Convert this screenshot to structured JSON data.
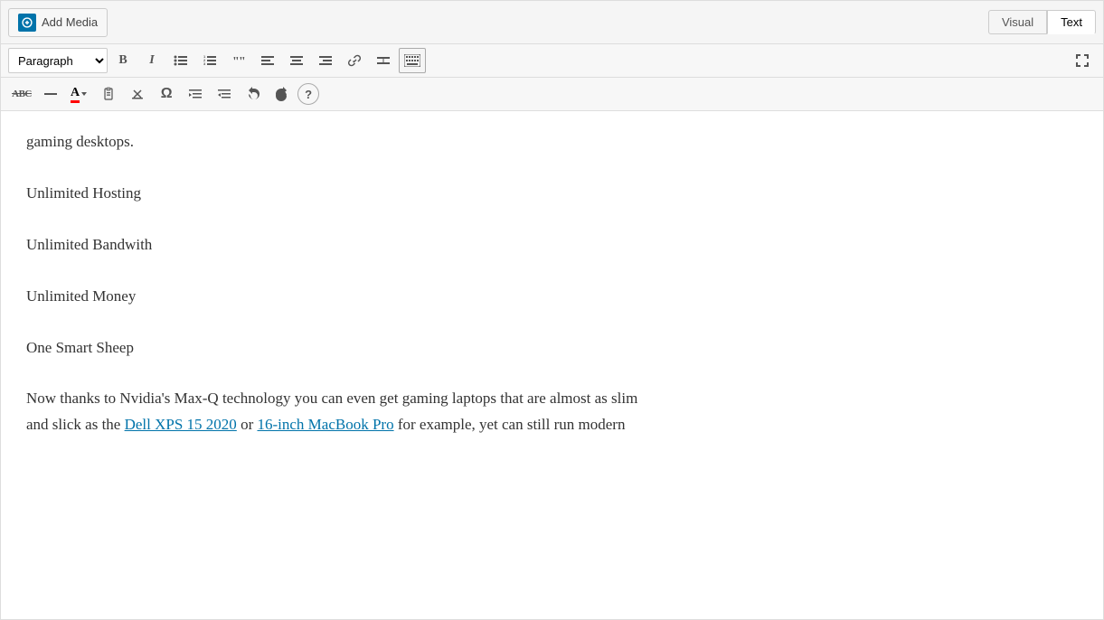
{
  "header": {
    "add_media_label": "Add Media",
    "visual_tab": "Visual",
    "text_tab": "Text"
  },
  "toolbar1": {
    "paragraph_label": "Paragraph",
    "bold_label": "B",
    "italic_label": "I",
    "bullets_label": "≡",
    "numbered_label": "≡",
    "quote_label": "❝",
    "align_left_label": "≡",
    "align_center_label": "≡",
    "align_right_label": "≡",
    "link_label": "🔗",
    "more_label": "—",
    "keyboard_label": "⌨",
    "expand_label": "⤢"
  },
  "toolbar2": {
    "abc_label": "ABC",
    "hr_label": "—",
    "text_color_label": "A",
    "paste_label": "📋",
    "clear_label": "◇",
    "omega_label": "Ω",
    "indent_label": "→",
    "outdent_label": "←",
    "undo_label": "↩",
    "redo_label": "↪",
    "help_label": "?"
  },
  "content": {
    "line1": "gaming desktops.",
    "item1": "Unlimited Hosting",
    "item2": "Unlimited Bandwith",
    "item3": "Unlimited Money",
    "item4": "One Smart Sheep",
    "paragraph1_start": "Now thanks to Nvidia's Max-Q technology you can even get gaming laptops that are almost as slim",
    "paragraph1_mid": "and slick as the ",
    "link1": "Dell XPS 15 2020",
    "paragraph1_mid2": " or ",
    "link2": "16-inch MacBook Pro",
    "paragraph1_end": " for example, yet can still run modern"
  }
}
